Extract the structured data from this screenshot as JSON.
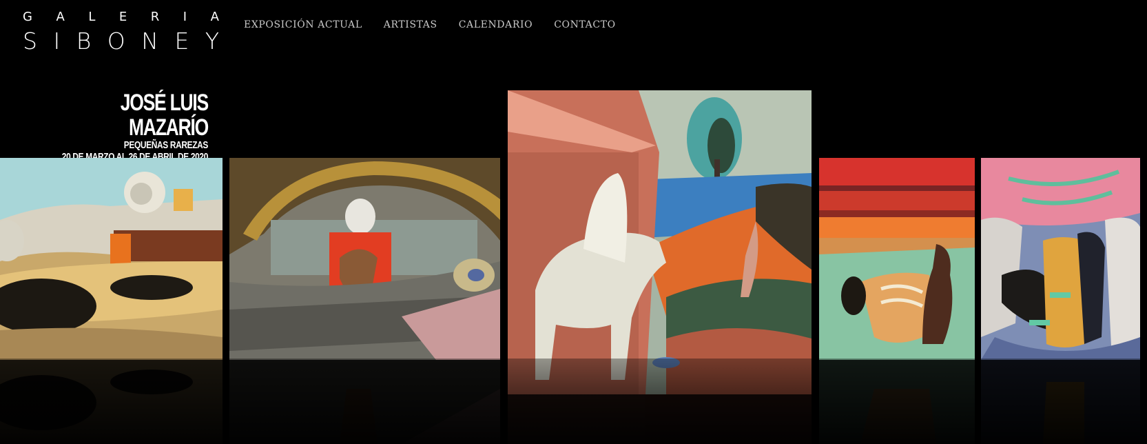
{
  "logo": {
    "line1": [
      "G",
      "A",
      "L",
      "E",
      "R",
      "I",
      "A"
    ],
    "line2": [
      "S",
      "I",
      "B",
      "O",
      "N",
      "E",
      "Y"
    ]
  },
  "nav": {
    "items": [
      {
        "label": "EXPOSICIÓN ACTUAL"
      },
      {
        "label": "ARTISTAS"
      },
      {
        "label": "CALENDARIO"
      },
      {
        "label": "CONTACTO"
      }
    ]
  },
  "exhibition": {
    "artist": "JOSÉ LUIS MAZARÍO",
    "title": "PEQUEÑAS RAREZAS",
    "dates": "20 DE MARZO AL 26 DE ABRIL DE 2020"
  },
  "colors": {
    "background": "#000000",
    "nav_text": "#c9c9c9",
    "logo_text": "#ffffff"
  }
}
